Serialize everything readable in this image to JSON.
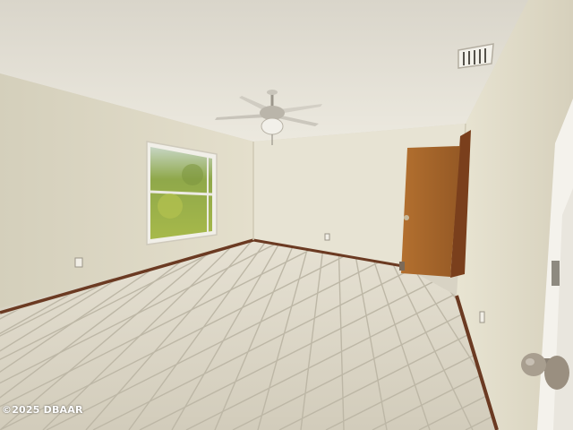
{
  "photo": {
    "subject": "empty-room-interior",
    "watermark": "©2025 DBAAR"
  },
  "colors": {
    "ceiling": "#ece9df",
    "wall_left": "#dcd6c2",
    "wall_back": "#e7e3d3",
    "wall_right": "#e2ddc9",
    "floor_tile": "#d9d4c4",
    "grout": "#bdb7a6",
    "baseboard": "#6b3a22",
    "door_wood": "#a0622a",
    "door_frame": "#7a3f1c",
    "window_foliage": "#9bb04a",
    "knob": "#9a8f80"
  },
  "icons": [
    "ceiling-fan-icon",
    "air-vent-icon",
    "door-knob-icon",
    "electrical-outlet-icon"
  ]
}
